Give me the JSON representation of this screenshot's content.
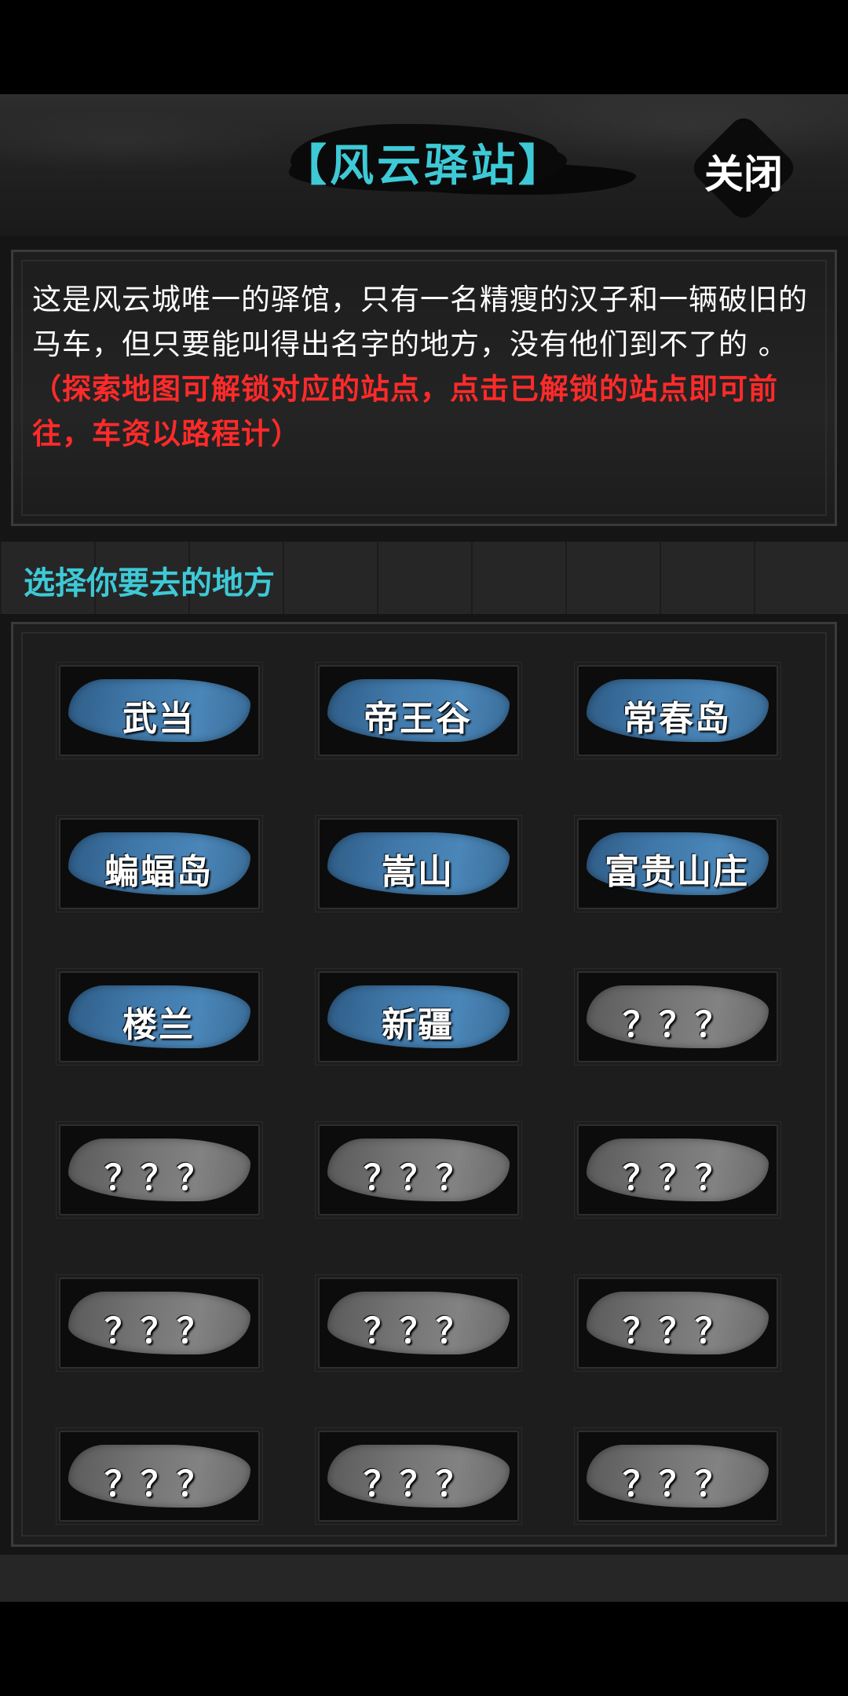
{
  "header": {
    "title": "【风云驿站】",
    "close_label": "关闭"
  },
  "description": {
    "text": "这是风云城唯一的驿馆，只有一名精瘦的汉子和一辆破旧的马车，但只要能叫得出名字的地方，没有他们到不了的 。",
    "hint": "（探索地图可解锁对应的站点，点击已解锁的站点即可前往，车资以路程计）"
  },
  "subtitle": "选择你要去的地方",
  "stations": [
    {
      "label": "武当",
      "unlocked": true
    },
    {
      "label": "帝王谷",
      "unlocked": true
    },
    {
      "label": "常春岛",
      "unlocked": true
    },
    {
      "label": "蝙蝠岛",
      "unlocked": true
    },
    {
      "label": "嵩山",
      "unlocked": true
    },
    {
      "label": "富贵山庄",
      "unlocked": true
    },
    {
      "label": "楼兰",
      "unlocked": true
    },
    {
      "label": "新疆",
      "unlocked": true
    },
    {
      "label": "？？？",
      "unlocked": false
    },
    {
      "label": "？？？",
      "unlocked": false
    },
    {
      "label": "？？？",
      "unlocked": false
    },
    {
      "label": "？？？",
      "unlocked": false
    },
    {
      "label": "？？？",
      "unlocked": false
    },
    {
      "label": "？？？",
      "unlocked": false
    },
    {
      "label": "？？？",
      "unlocked": false
    },
    {
      "label": "？？？",
      "unlocked": false
    },
    {
      "label": "？？？",
      "unlocked": false
    },
    {
      "label": "？？？",
      "unlocked": false
    }
  ],
  "colors": {
    "accent": "#3ec9d6",
    "hint": "#ff2a2a",
    "unlocked_paint": "#3f77a8",
    "locked_paint": "#747474"
  }
}
